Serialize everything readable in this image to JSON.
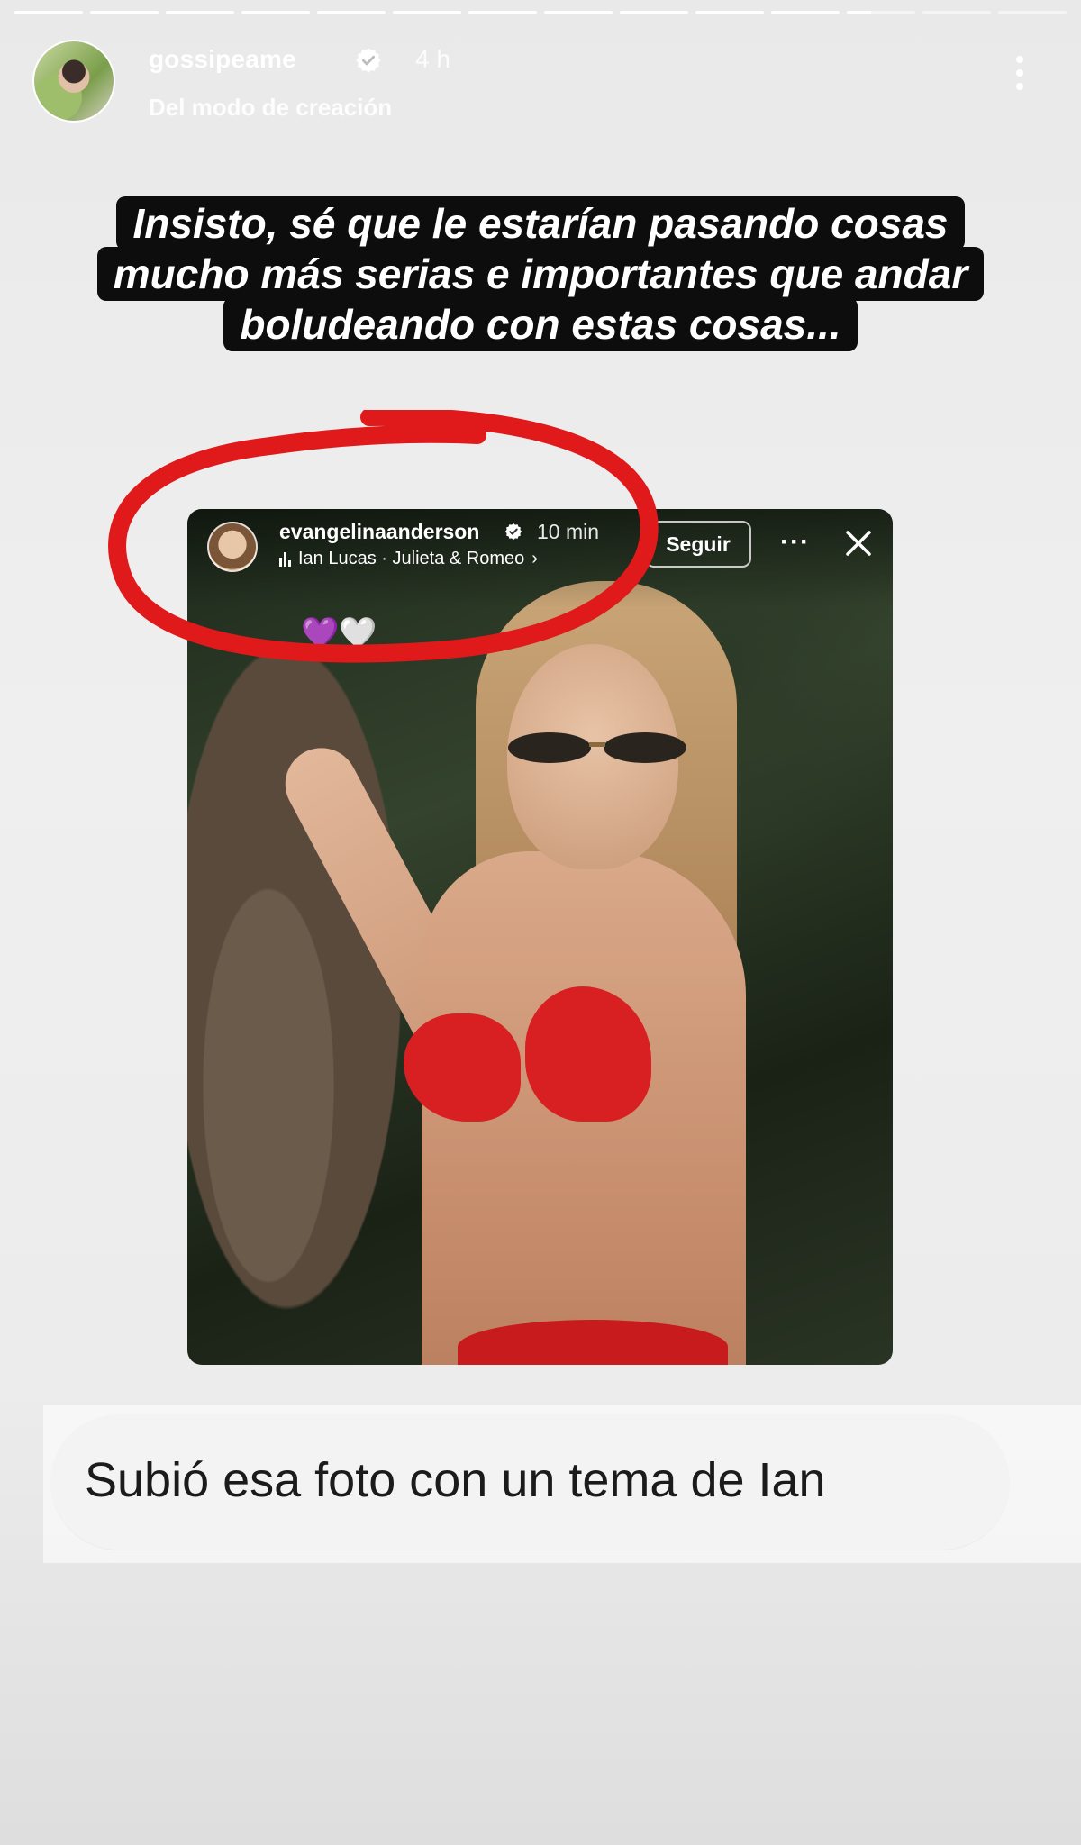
{
  "story": {
    "progress_segments": 14,
    "active_segment_index": 11,
    "active_segment_progress": 0.35
  },
  "header": {
    "username": "gossipeame",
    "time": "4 h",
    "subtitle": "Del modo de creación"
  },
  "caption": {
    "lines": [
      "Insisto, sé que le estarían pasando cosas",
      "mucho más serias e importantes que andar",
      "boludeando con estas cosas..."
    ]
  },
  "embedded_story": {
    "username": "evangelinaanderson",
    "time": "10 min",
    "music": "Ian Lucas · Julieta & Romeo",
    "follow_label": "Seguir",
    "more_label": "···",
    "reaction": "💜🤍"
  },
  "annotation": {
    "circle_color": "#e0191b"
  },
  "bubble": {
    "text": "Subió esa foto con un tema de Ian"
  }
}
